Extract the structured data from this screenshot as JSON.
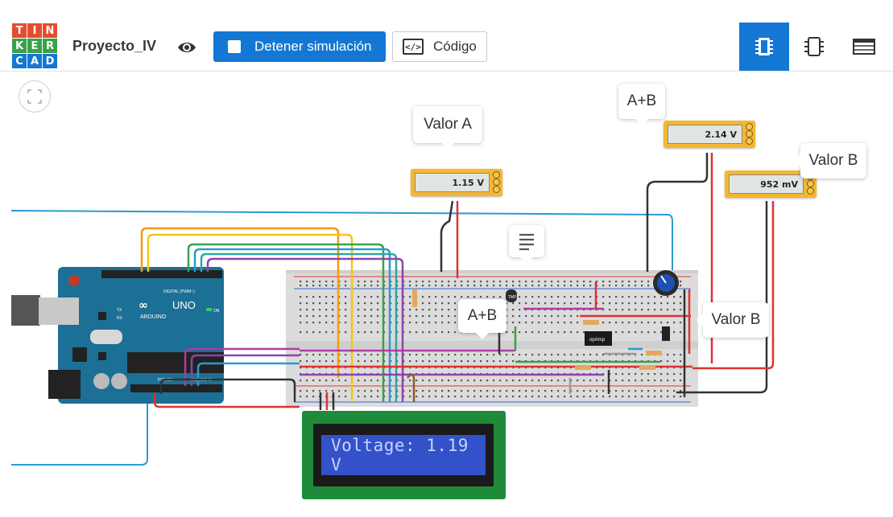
{
  "header": {
    "logo_letters": [
      "T",
      "I",
      "N",
      "K",
      "E",
      "R",
      "C",
      "A",
      "D"
    ],
    "logo_colors": [
      "#e64c2f",
      "#e64c2f",
      "#e64c2f",
      "#3aa148",
      "#3aa148",
      "#3aa148",
      "#1477d4",
      "#1477d4",
      "#1477d4"
    ],
    "project_name": "Proyecto_IV",
    "stop_sim_label": "Detener simulación",
    "code_label": "Código",
    "code_icon_glyph": "</>"
  },
  "views": [
    {
      "name": "schematic-view-icon",
      "active": true
    },
    {
      "name": "component-view-icon",
      "active": false
    },
    {
      "name": "component-list-icon",
      "active": false
    }
  ],
  "accent_color": "#1477d4",
  "labels": {
    "valor_a": "Valor A",
    "a_plus_b_top": "A+B",
    "valor_b_top": "Valor B",
    "valor_b_right": "Valor B",
    "a_plus_b_mid": "A+B"
  },
  "meters": {
    "valor_a": "1.15 V",
    "a_plus_b": "2.14 V",
    "valor_b": "952 mV"
  },
  "lcd": {
    "text": "Voltage: 1.19 V"
  },
  "arduino": {
    "brand": "ARDUINO",
    "model": "UNO",
    "digital_label": "DIGITAL (PWM~)",
    "power_label": "POWER",
    "analog_label": "ANALOG IN",
    "on_label": "ON",
    "tx_label": "TX",
    "rx_label": "RX",
    "aref_label": "AREF"
  },
  "components": {
    "opamp_label": "opAmp",
    "tmp_label": "TMP"
  }
}
